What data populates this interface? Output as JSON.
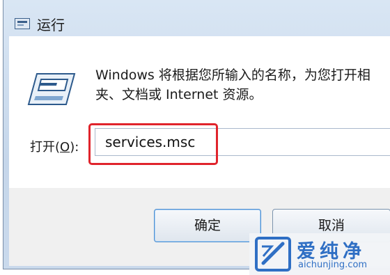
{
  "window": {
    "title": "运行"
  },
  "dialog": {
    "description": "Windows 将根据您所输入的名称，为您打开相\n夹、文档或 Internet 资源。",
    "open_label_prefix": "打开(",
    "open_label_key": "O",
    "open_label_suffix": "):",
    "input_value": "services.msc"
  },
  "buttons": {
    "ok": "确定",
    "cancel": "取消"
  },
  "watermark": {
    "brand": "爱纯净",
    "url": "aichunjing.com"
  },
  "colors": {
    "highlight": "#e0242c",
    "brand": "#2f6fc4"
  },
  "icons": {
    "title": "run-window-icon",
    "main": "run-window-icon",
    "watermark": "aichunjing-logo-icon"
  }
}
